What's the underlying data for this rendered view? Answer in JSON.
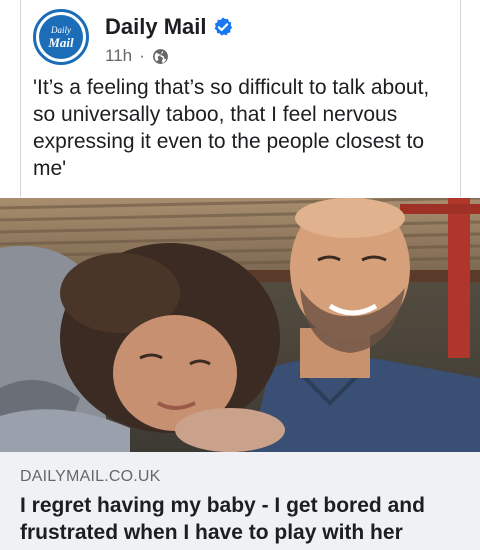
{
  "post": {
    "page_name": "Daily Mail",
    "avatar_line1": "Daily",
    "avatar_line2": "Mail",
    "time": "11h",
    "separator": "·",
    "privacy_icon": "globe-icon",
    "verified_icon": "verified-badge-icon",
    "text": "'It’s a feeling that’s so difficult to talk about, so universally taboo, that I feel nervous expressing it even to the people closest to me'"
  },
  "link": {
    "domain": "DAILYMAIL.CO.UK",
    "headline": "I regret having my baby - I get bored and frustrated when I have to play with her"
  },
  "colors": {
    "brand_blue": "#1b6db8",
    "verified_blue": "#1877f2",
    "secondary_text": "#65676b",
    "preview_bg": "#eff1f4"
  }
}
